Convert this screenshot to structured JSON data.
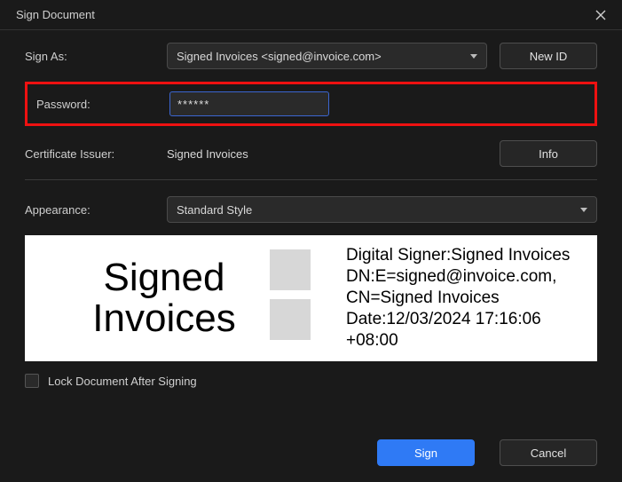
{
  "title": "Sign Document",
  "labels": {
    "sign_as": "Sign As:",
    "password": "Password:",
    "issuer": "Certificate Issuer:",
    "appearance": "Appearance:",
    "lock": "Lock Document After Signing"
  },
  "sign_as": {
    "selected": "Signed Invoices <signed@invoice.com>"
  },
  "password": {
    "value": "******"
  },
  "issuer_value": "Signed Invoices",
  "appearance_selected": "Standard Style",
  "buttons": {
    "new_id": "New ID",
    "info": "Info",
    "sign": "Sign",
    "cancel": "Cancel"
  },
  "preview": {
    "name": "Signed\nInvoices",
    "details": "Digital Signer:Signed Invoices\nDN:E=signed@invoice.com,\nCN=Signed Invoices\nDate:12/03/2024 17:16:06\n+08:00"
  }
}
